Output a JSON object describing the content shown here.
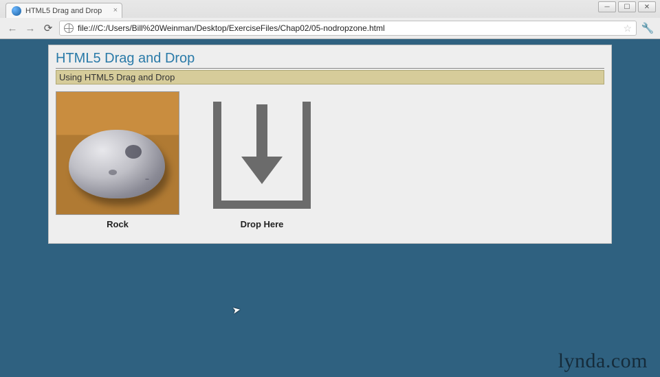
{
  "browser": {
    "tab_title": "HTML5 Drag and Drop",
    "url": "file:///C:/Users/Bill%20Weinman/Desktop/ExerciseFiles/Chap02/05-nodropzone.html"
  },
  "page": {
    "heading": "HTML5 Drag and Drop",
    "subheading": "Using HTML5 Drag and Drop",
    "draggable_label": "Rock",
    "dropzone_label": "Drop Here"
  },
  "watermark": "lynda.com"
}
